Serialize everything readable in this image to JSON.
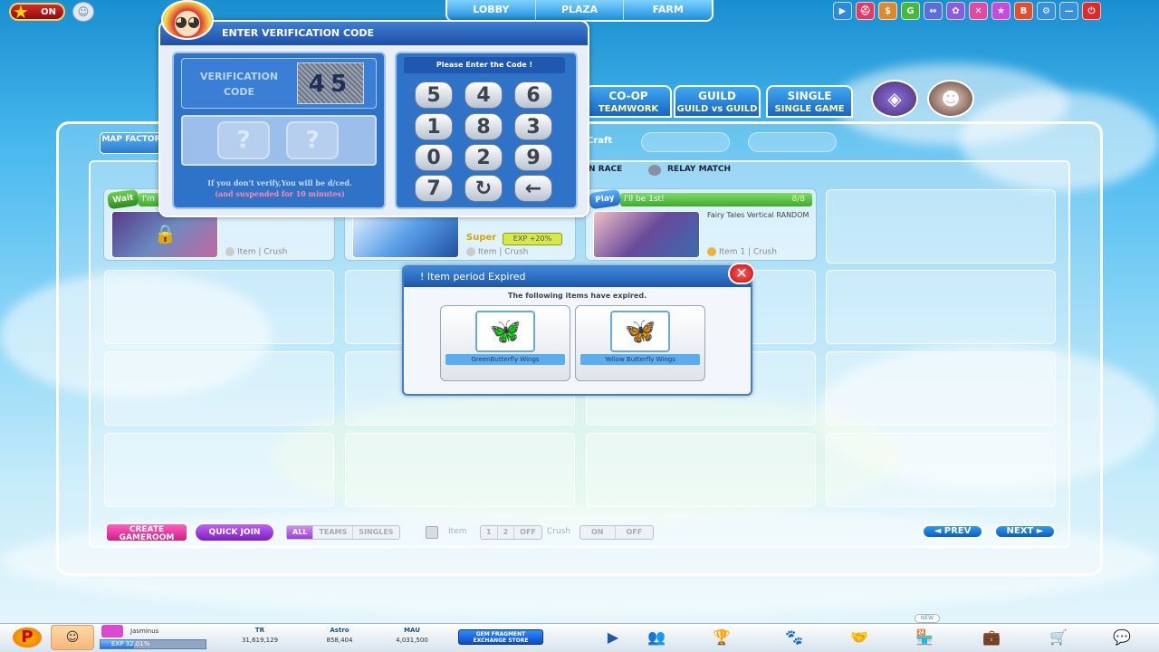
{
  "topbar": {
    "online_toggle": "ON",
    "nav": [
      "LOBBY",
      "PLAZA",
      "FARM"
    ],
    "icons": [
      {
        "name": "play-icon",
        "glyph": "▶",
        "color": "#2a8ae0"
      },
      {
        "name": "hat-icon",
        "glyph": "⛑",
        "color": "#e03a68"
      },
      {
        "name": "store-icon",
        "glyph": "$",
        "color": "#e0892b"
      },
      {
        "name": "g-icon",
        "glyph": "G",
        "color": "#46b83c"
      },
      {
        "name": "swap-icon",
        "glyph": "⇔",
        "color": "#5a6ee0"
      },
      {
        "name": "settings-gear-icon",
        "glyph": "✿",
        "color": "#8b5ce0"
      },
      {
        "name": "sword-icon",
        "glyph": "✕",
        "color": "#e04aa0"
      },
      {
        "name": "star-icon",
        "glyph": "★",
        "color": "#c84ae0"
      },
      {
        "name": "book-icon",
        "glyph": "B",
        "color": "#e05030"
      },
      {
        "name": "gear-icon",
        "glyph": "⚙",
        "color": "#3a90e0"
      },
      {
        "name": "minimize-icon",
        "glyph": "—",
        "color": "#3a90e0"
      },
      {
        "name": "power-icon",
        "glyph": "⏻",
        "color": "#e02a2a"
      }
    ]
  },
  "modes": {
    "coop": {
      "title": "CO-OP",
      "sub": "TEAMWORK"
    },
    "guild": {
      "title": "GUILD",
      "sub": "GUILD vs GUILD"
    },
    "single": {
      "title": "SINGLE",
      "sub": "SINGLE GAME"
    }
  },
  "toolbar": {
    "map_factory": "MAP FACTORY",
    "craft": "Craft",
    "race_partial": "N RACE",
    "relay_match": "RELAY MATCH"
  },
  "rooms": [
    {
      "badge": "Wait",
      "header": "I'm",
      "count": "",
      "title": "",
      "item": "Item",
      "crush": "Crush"
    },
    {
      "badge": "",
      "header": "",
      "count": "",
      "title": "",
      "item": "Item",
      "crush": "Crush",
      "super": "Super",
      "exp_bonus": "EXP +20%"
    },
    {
      "badge": "Play",
      "header": "I'll be 1st!",
      "count": "8/8",
      "title": "Fairy Tales Vertical RANDOM",
      "item": "Item 1",
      "crush": "Crush"
    }
  ],
  "controls": {
    "create": "CREATE GAMEROOM",
    "quick_join": "QUICK JOIN",
    "filters": [
      "ALL",
      "TEAMS",
      "SINGLES"
    ],
    "item_label": "Item",
    "item_opts": [
      "1",
      "2",
      "OFF"
    ],
    "crush_label": "Crush",
    "crush_opts": [
      "ON",
      "OFF"
    ],
    "prev": "◄ PREV",
    "next": "NEXT ►"
  },
  "verification": {
    "title": "ENTER VERIFICATION CODE",
    "code_label": "VERIFICATION CODE",
    "captcha": "45",
    "placeholder": [
      "?",
      "?"
    ],
    "warn1": "If you don't verify,You will be d/ced.",
    "warn2": "(and suspended for 10 minutes)",
    "prompt": "Please Enter the Code !",
    "keys": [
      "5",
      "4",
      "6",
      "1",
      "8",
      "3",
      "0",
      "2",
      "9",
      "7",
      "↻",
      "←"
    ]
  },
  "expired": {
    "title": "! Item period Expired",
    "message": "The following items have expired.",
    "close": "✕",
    "items": [
      {
        "name": "GreenButterfly Wings",
        "glyph": "🦋",
        "color": "#5fdc3a"
      },
      {
        "name": "Yellow Butterfly Wings",
        "glyph": "🦋",
        "color": "#f2d82b"
      }
    ]
  },
  "statusbar": {
    "rank_letter": "P",
    "username": "Jasminus",
    "exp_label": "EXP 32.01%",
    "exp_fraction": 0.3201,
    "stats": [
      {
        "label": "TR",
        "value": "31,619,129"
      },
      {
        "label": "Astro",
        "value": "858,404"
      },
      {
        "label": "MAU",
        "value": "4,031,500"
      }
    ],
    "gem_store": "GEM FRAGMENT EXCHANGE STORE",
    "new_tag": "NEW"
  }
}
